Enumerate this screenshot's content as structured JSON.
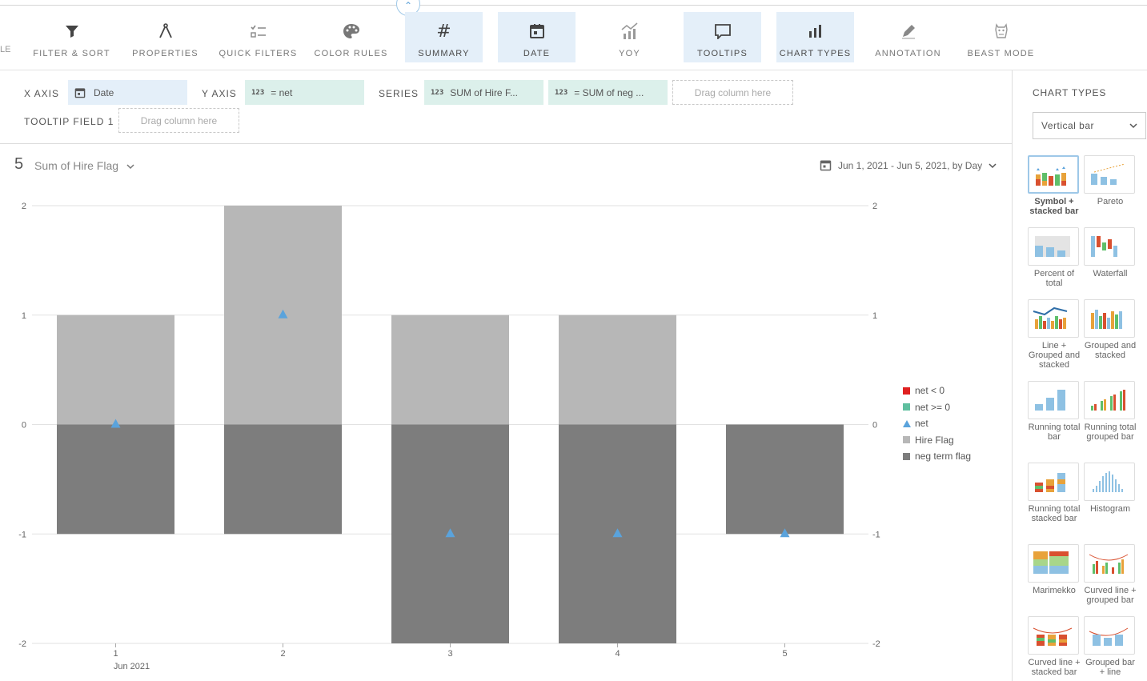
{
  "toolbar": {
    "cut_label": "LE",
    "buttons": [
      {
        "label": "FILTER & SORT",
        "active": true,
        "icon": "filter-icon"
      },
      {
        "label": "PROPERTIES",
        "active": true,
        "icon": "compass-icon"
      },
      {
        "label": "QUICK FILTERS",
        "active": false,
        "icon": "checklist-icon"
      },
      {
        "label": "COLOR RULES",
        "active": false,
        "icon": "palette-icon"
      },
      {
        "label": "SUMMARY",
        "active": true,
        "icon": "hash-icon"
      },
      {
        "label": "DATE",
        "active": true,
        "icon": "calendar-icon"
      },
      {
        "label": "YOY",
        "active": false,
        "icon": "yoy-chart-icon"
      },
      {
        "label": "TOOLTIPS",
        "active": true,
        "icon": "speech-bubble-icon"
      },
      {
        "label": "CHART TYPES",
        "active": true,
        "icon": "bar-chart-icon"
      },
      {
        "label": "ANNOTATION",
        "active": false,
        "icon": "pencil-icon"
      },
      {
        "label": "BEAST MODE",
        "active": false,
        "icon": "beast-icon"
      }
    ]
  },
  "config": {
    "x_axis_label": "X AXIS",
    "x_axis_value": "Date",
    "y_axis_label": "Y AXIS",
    "y_axis_type": "123",
    "y_axis_value": "= net",
    "series_label": "SERIES",
    "series_1_type": "123",
    "series_1_value": "SUM of Hire F...",
    "series_2_type": "123",
    "series_2_value": "= SUM of neg ...",
    "drop_series": "Drag column here",
    "tooltip_label": "TOOLTIP FIELD 1",
    "drop_tooltip": "Drag column here"
  },
  "header": {
    "summary_number": "5",
    "metric": "Sum of Hire Flag",
    "date_range": "Jun 1, 2021 - Jun 5, 2021, by Day"
  },
  "chart_data": {
    "type": "bar",
    "stacked": true,
    "categories": [
      "1",
      "2",
      "3",
      "4",
      "5"
    ],
    "x_sublabel": "Jun 2021",
    "ylim": [
      -2,
      2
    ],
    "yticks": [
      2,
      1,
      0,
      -1,
      -2
    ],
    "series": [
      {
        "name": "Hire Flag",
        "kind": "bar",
        "color": "#b7b7b7",
        "values": [
          1,
          2,
          1,
          1,
          0
        ]
      },
      {
        "name": "neg term flag",
        "kind": "bar",
        "color": "#7d7d7d",
        "values": [
          -1,
          -1,
          -2,
          -2,
          -1
        ]
      },
      {
        "name": "net",
        "kind": "symbol",
        "color": "#5aa3dc",
        "values": [
          0,
          1,
          -1,
          -1,
          -1
        ]
      }
    ],
    "legend": [
      {
        "name": "net < 0",
        "color": "#e02020",
        "shape": "square"
      },
      {
        "name": "net >= 0",
        "color": "#5fbf9f",
        "shape": "square"
      },
      {
        "name": "net",
        "color": "#5aa3dc",
        "shape": "triangle"
      },
      {
        "name": "Hire Flag",
        "color": "#b7b7b7",
        "shape": "square"
      },
      {
        "name": "neg term flag",
        "color": "#7d7d7d",
        "shape": "square"
      }
    ],
    "legend_position": "right",
    "grid": true
  },
  "panel": {
    "title": "CHART TYPES",
    "selected_type": "Vertical bar",
    "types": [
      {
        "name": "Symbol + stacked bar",
        "selected": true
      },
      {
        "name": "Pareto",
        "selected": false
      },
      {
        "name": "Percent of total",
        "selected": false
      },
      {
        "name": "Waterfall",
        "selected": false
      },
      {
        "name": "Line + Grouped and stacked",
        "selected": false
      },
      {
        "name": "Grouped and stacked",
        "selected": false
      },
      {
        "name": "Running total bar",
        "selected": false
      },
      {
        "name": "Running total grouped bar",
        "selected": false
      },
      {
        "name": "Running total stacked bar",
        "selected": false
      },
      {
        "name": "Histogram",
        "selected": false
      },
      {
        "name": "Marimekko",
        "selected": false
      },
      {
        "name": "Curved line + grouped bar",
        "selected": false
      },
      {
        "name": "Curved line + stacked bar",
        "selected": false
      },
      {
        "name": "Grouped bar + line",
        "selected": false
      }
    ]
  }
}
